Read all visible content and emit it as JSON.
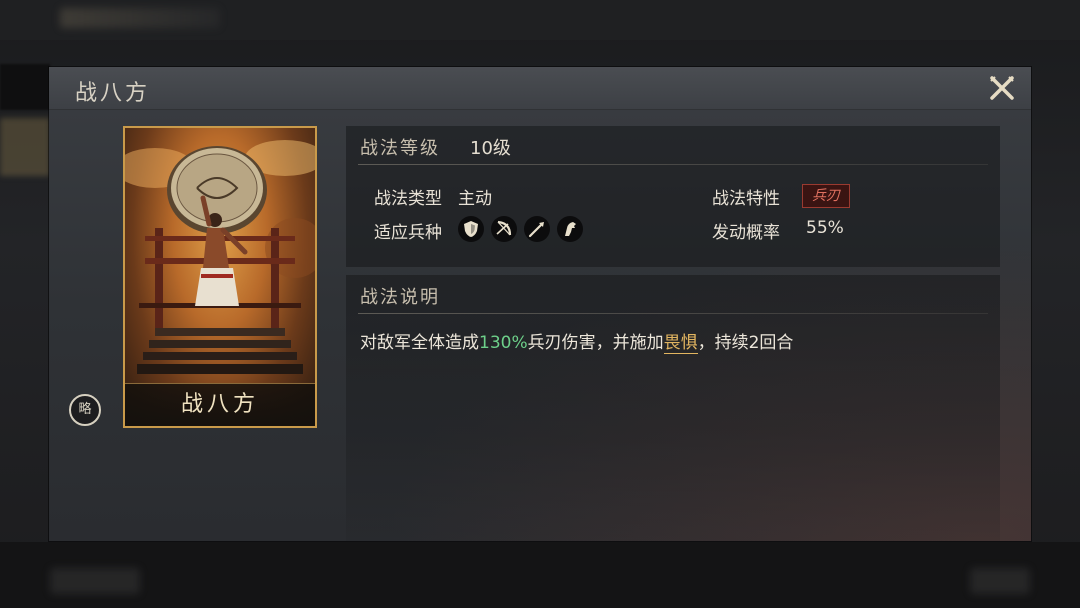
{
  "dialog": {
    "title": "战八方"
  },
  "card": {
    "name": "战八方",
    "strategy_badge": "略"
  },
  "info": {
    "level_label": "战法等级",
    "level_value": "10级",
    "type_label": "战法类型",
    "type_value": "主动",
    "trait_label": "战法特性",
    "trait_value": "兵刃",
    "units_label": "适应兵种",
    "units": [
      {
        "icon": "shield-icon"
      },
      {
        "icon": "bow-icon"
      },
      {
        "icon": "spear-icon"
      },
      {
        "icon": "horse-icon"
      }
    ],
    "rate_label": "发动概率",
    "rate_value": "55%"
  },
  "description": {
    "title": "战法说明",
    "part1": "对敌军全体造成",
    "percent": "130%",
    "part2": "兵刃伤害，并施加",
    "status": "畏惧",
    "part3": "，持续2回合"
  },
  "colors": {
    "accent_green": "#6dd08a",
    "accent_gold": "#e2b560",
    "trait_red": "#e07060",
    "card_border": "#c99a4a"
  }
}
